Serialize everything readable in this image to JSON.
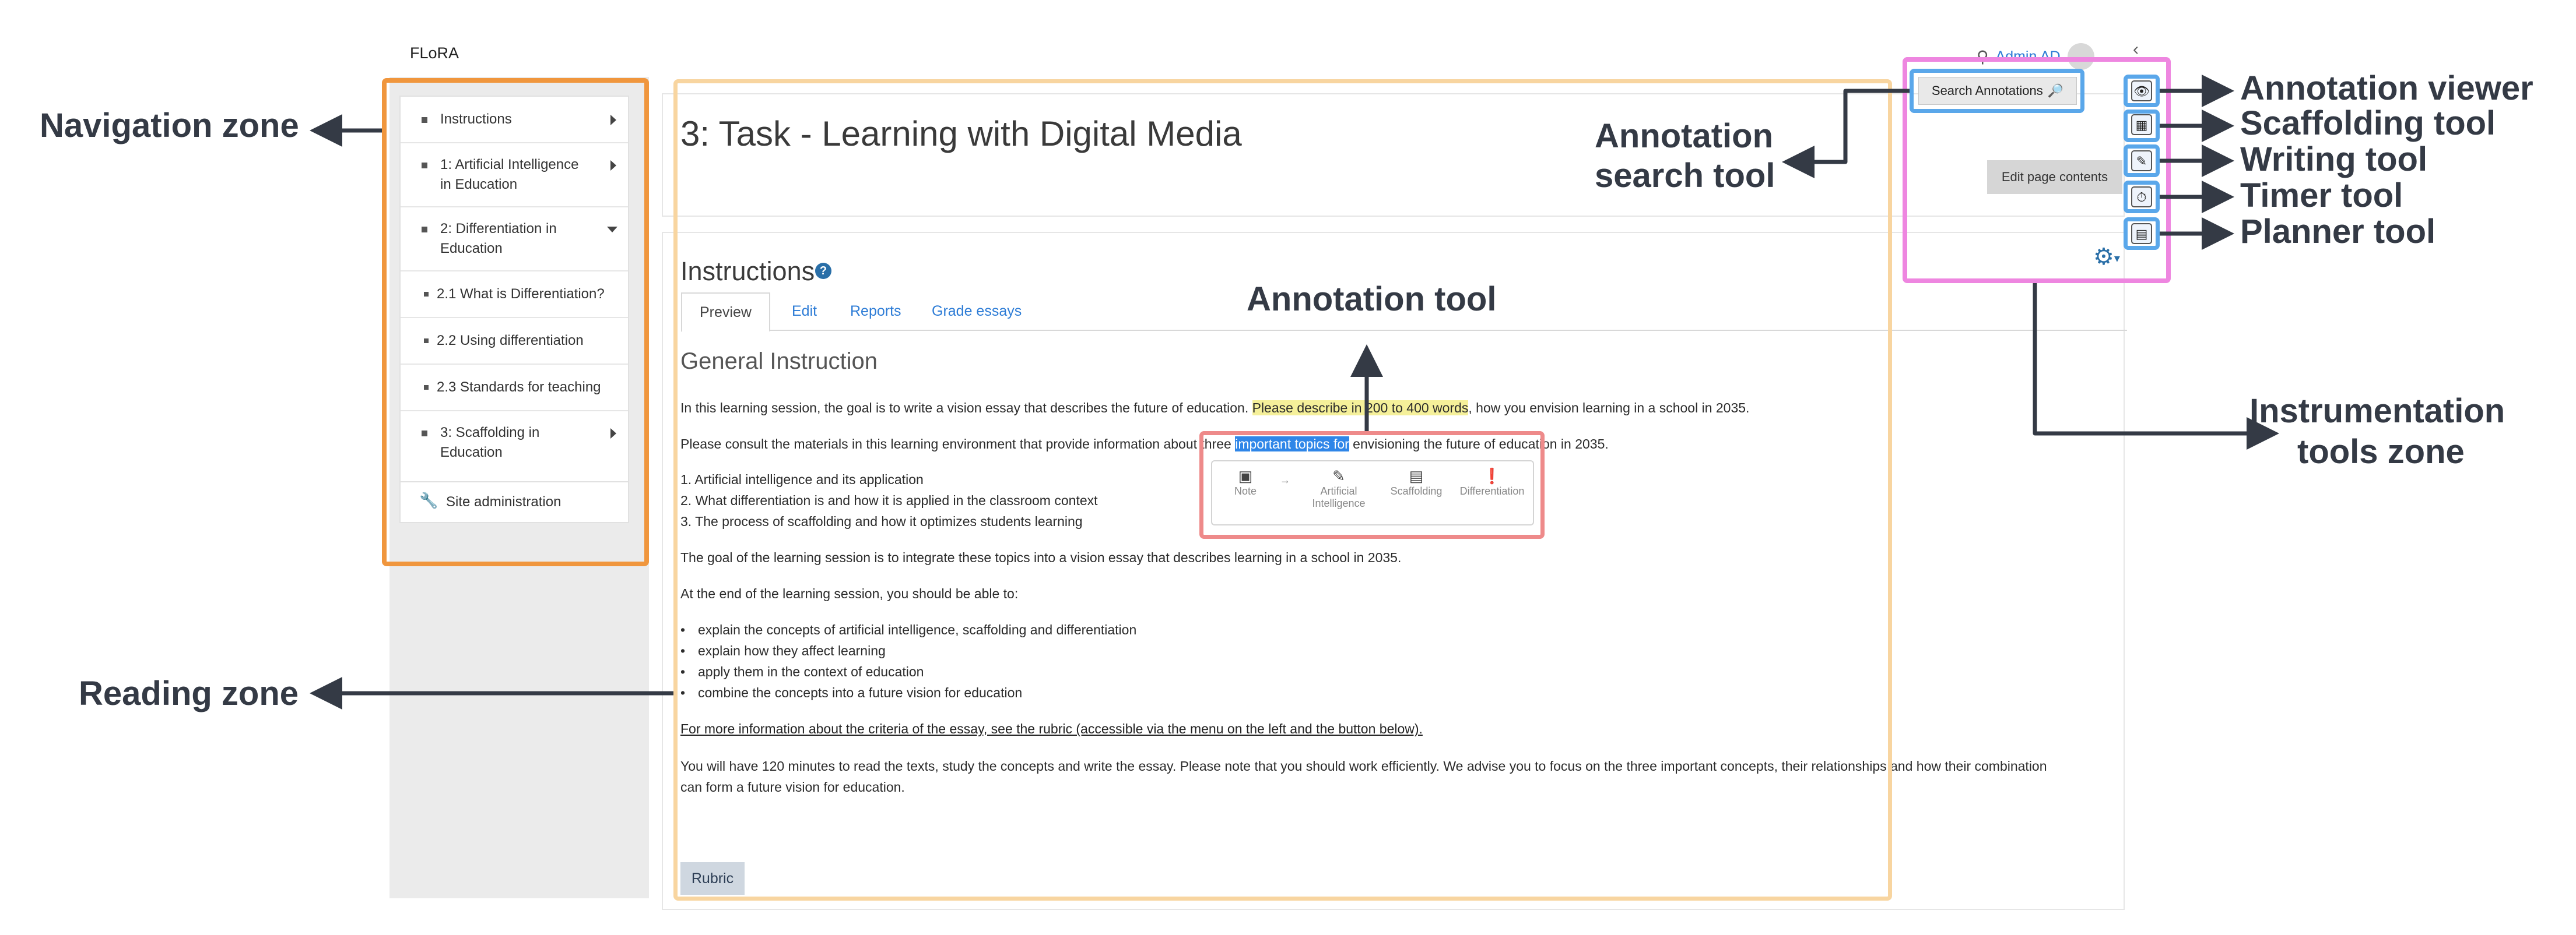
{
  "app": {
    "brand": "FLoRA",
    "user_name": "Admin AD",
    "collapse_glyph": "‹"
  },
  "nav": {
    "items": [
      {
        "label": "Instructions",
        "expandable": true
      },
      {
        "label": "1: Artificial Intelligence in Education",
        "expandable": true
      },
      {
        "label": "2: Differentiation in Education",
        "expanded": true
      },
      {
        "label": "2.1 What is Differentiation?"
      },
      {
        "label": "2.2 Using differentiation"
      },
      {
        "label": "2.3 Standards for teaching"
      },
      {
        "label": "3: Scaffolding in Education",
        "expandable": true
      }
    ],
    "site_admin": "Site administration"
  },
  "page": {
    "title": "3: Task - Learning with Digital Media",
    "section_title": "Instructions",
    "tabs": [
      "Preview",
      "Edit",
      "Reports",
      "Grade essays"
    ],
    "active_tab": "Preview",
    "subheading": "General Instruction",
    "para1_a": "In this learning session, the goal is to write a vision essay that describes the future of education. ",
    "para1_highlight": "Please describe in 200 to 400 words",
    "para1_b": ", how you envision learning in a school in 2035.",
    "para2_a": "Please consult the materials in this learning environment that provide information about three ",
    "para2_highlight": "important topics for",
    "para2_b": " envisioning the future of education in 2035.",
    "list1": [
      "1. Artificial intelligence and its application",
      "2. What differentiation is and how it is applied in the classroom context",
      "3. The process of scaffolding and how it optimizes students learning"
    ],
    "para3": "The goal of the learning session is to integrate these topics into a vision essay that describes learning in a school in 2035.",
    "para4": "At the end of the learning session, you should be able to:",
    "bullets": [
      "explain the concepts of artificial intelligence, scaffolding and differentiation",
      "explain how they affect learning",
      "apply them in the context of education",
      "combine the concepts into a future vision for education"
    ],
    "para5": "For more information about the criteria of the essay, see the rubric (accessible via the menu on the left and the button below).",
    "para6_line1": "You will have 120 minutes to read the texts, study the concepts and write the essay. Please note that you should work efficiently. We advise you to focus on the three important concepts, their relationships and how their combination",
    "para6_line2": "can form a future vision for education.",
    "rubric_button": "Rubric",
    "edit_page_button": "Edit page contents",
    "search_annotations_button": "Search Annotations"
  },
  "annotation_popup": {
    "items": [
      {
        "label": "Note",
        "icon": "note-icon"
      },
      {
        "label": "→",
        "icon": "arrow-icon"
      },
      {
        "label": "Artificial Intelligence",
        "icon": "pencil-icon"
      },
      {
        "label": "Scaffolding",
        "icon": "scaffolding-icon"
      },
      {
        "label": "Differentiation",
        "icon": "alert-icon"
      }
    ]
  },
  "callouts": {
    "navigation_zone": "Navigation zone",
    "reading_zone": "Reading zone",
    "annotation_tool": "Annotation tool",
    "annotation_search_tool_line1": "Annotation",
    "annotation_search_tool_line2": "search tool",
    "annotation_viewer": "Annotation viewer",
    "scaffolding_tool": "Scaffolding tool",
    "writing_tool": "Writing tool",
    "timer_tool": "Timer tool",
    "planner_tool": "Planner tool",
    "instrumentation_zone_line1": "Instrumentation",
    "instrumentation_zone_line2": "tools zone"
  },
  "colors": {
    "navigation_zone": "#f0963d",
    "reading_zone": "#f8d5a0",
    "annotation_zone": "#ee8a8a",
    "instrumentation_zone": "#ee86e0",
    "tool_highlight": "#5aa7ea",
    "link": "#2d7cd6",
    "highlight_yellow": "#f5f09a",
    "highlight_blue": "#2f86e8"
  }
}
